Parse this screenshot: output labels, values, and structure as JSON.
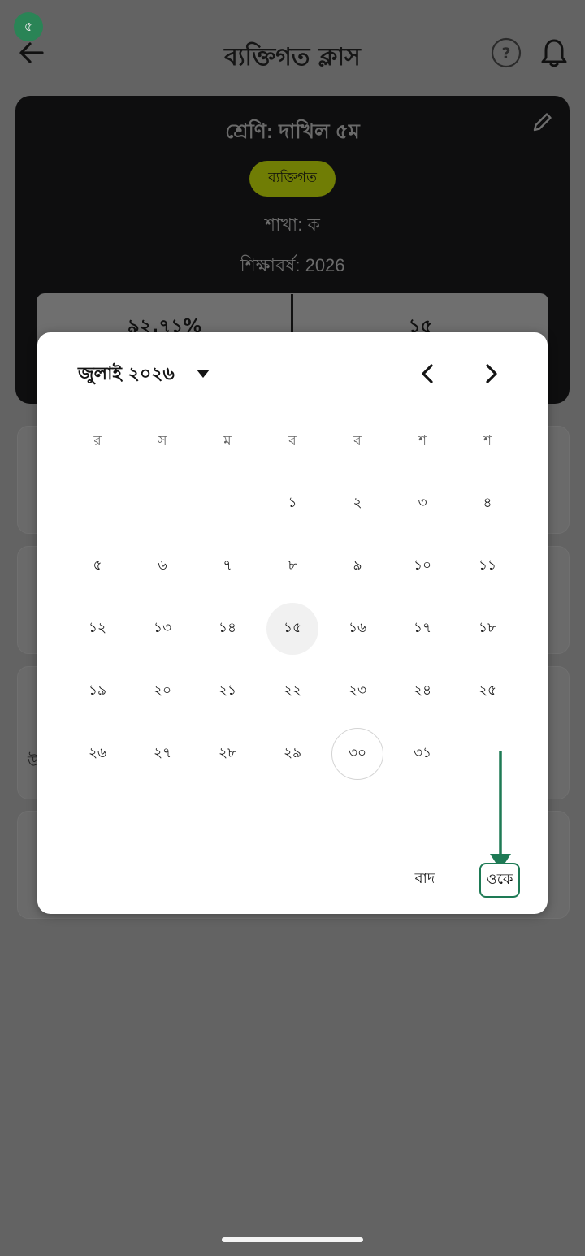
{
  "status": {
    "step_badge": "৫"
  },
  "header": {
    "title": "ব্যক্তিগত ক্লাস"
  },
  "class_card": {
    "class_name": "শ্রেণি: দাখিল ৫ম",
    "type_badge": "ব্যক্তিগত",
    "section": "শাখা: ক",
    "academic_year": "শিক্ষাবর্ষ: 2026",
    "stats": [
      "৯২.৭১%",
      "১৫"
    ]
  },
  "date_picker": {
    "month_year": "জুলাই ২০২৬",
    "weekdays": [
      "র",
      "স",
      "ম",
      "ব",
      "ব",
      "শ",
      "শ"
    ],
    "weeks": [
      [
        "",
        "",
        "",
        "১",
        "২",
        "৩",
        "৪"
      ],
      [
        "৫",
        "৬",
        "৭",
        "৮",
        "৯",
        "১০",
        "১১"
      ],
      [
        "১২",
        "১৩",
        "১৪",
        "১৫",
        "১৬",
        "১৭",
        "১৮"
      ],
      [
        "১৯",
        "২০",
        "২১",
        "২২",
        "২৩",
        "২৪",
        "২৫"
      ],
      [
        "২৬",
        "২৭",
        "২৮",
        "২৯",
        "৩০",
        "৩১",
        ""
      ]
    ],
    "selected_day": "১৫",
    "today": "৩০",
    "cancel_label": "বাদ",
    "ok_label": "ওকে"
  },
  "annotation": {
    "arrow_color": "#1e7a55"
  },
  "colors": {
    "accent_green": "#2a8456",
    "badge_olive": "#707d05",
    "card_dark": "#0e0e0f"
  }
}
